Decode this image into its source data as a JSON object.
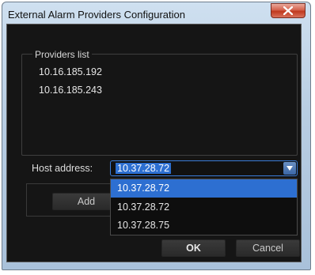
{
  "window": {
    "title": "External Alarm Providers Configuration"
  },
  "providers": {
    "label": "Providers list",
    "items": [
      "10.16.185.192",
      "10.16.185.243"
    ]
  },
  "host": {
    "label": "Host address:",
    "value": "10.37.28.72"
  },
  "dropdown": {
    "options": [
      "10.37.28.72",
      "10.37.28.72",
      "10.37.28.75"
    ],
    "selected_index": 0
  },
  "buttons": {
    "add": "Add",
    "ok": "OK",
    "cancel": "Cancel"
  },
  "colors": {
    "selection": "#2d6fd1",
    "close_button": "#c0391f"
  }
}
